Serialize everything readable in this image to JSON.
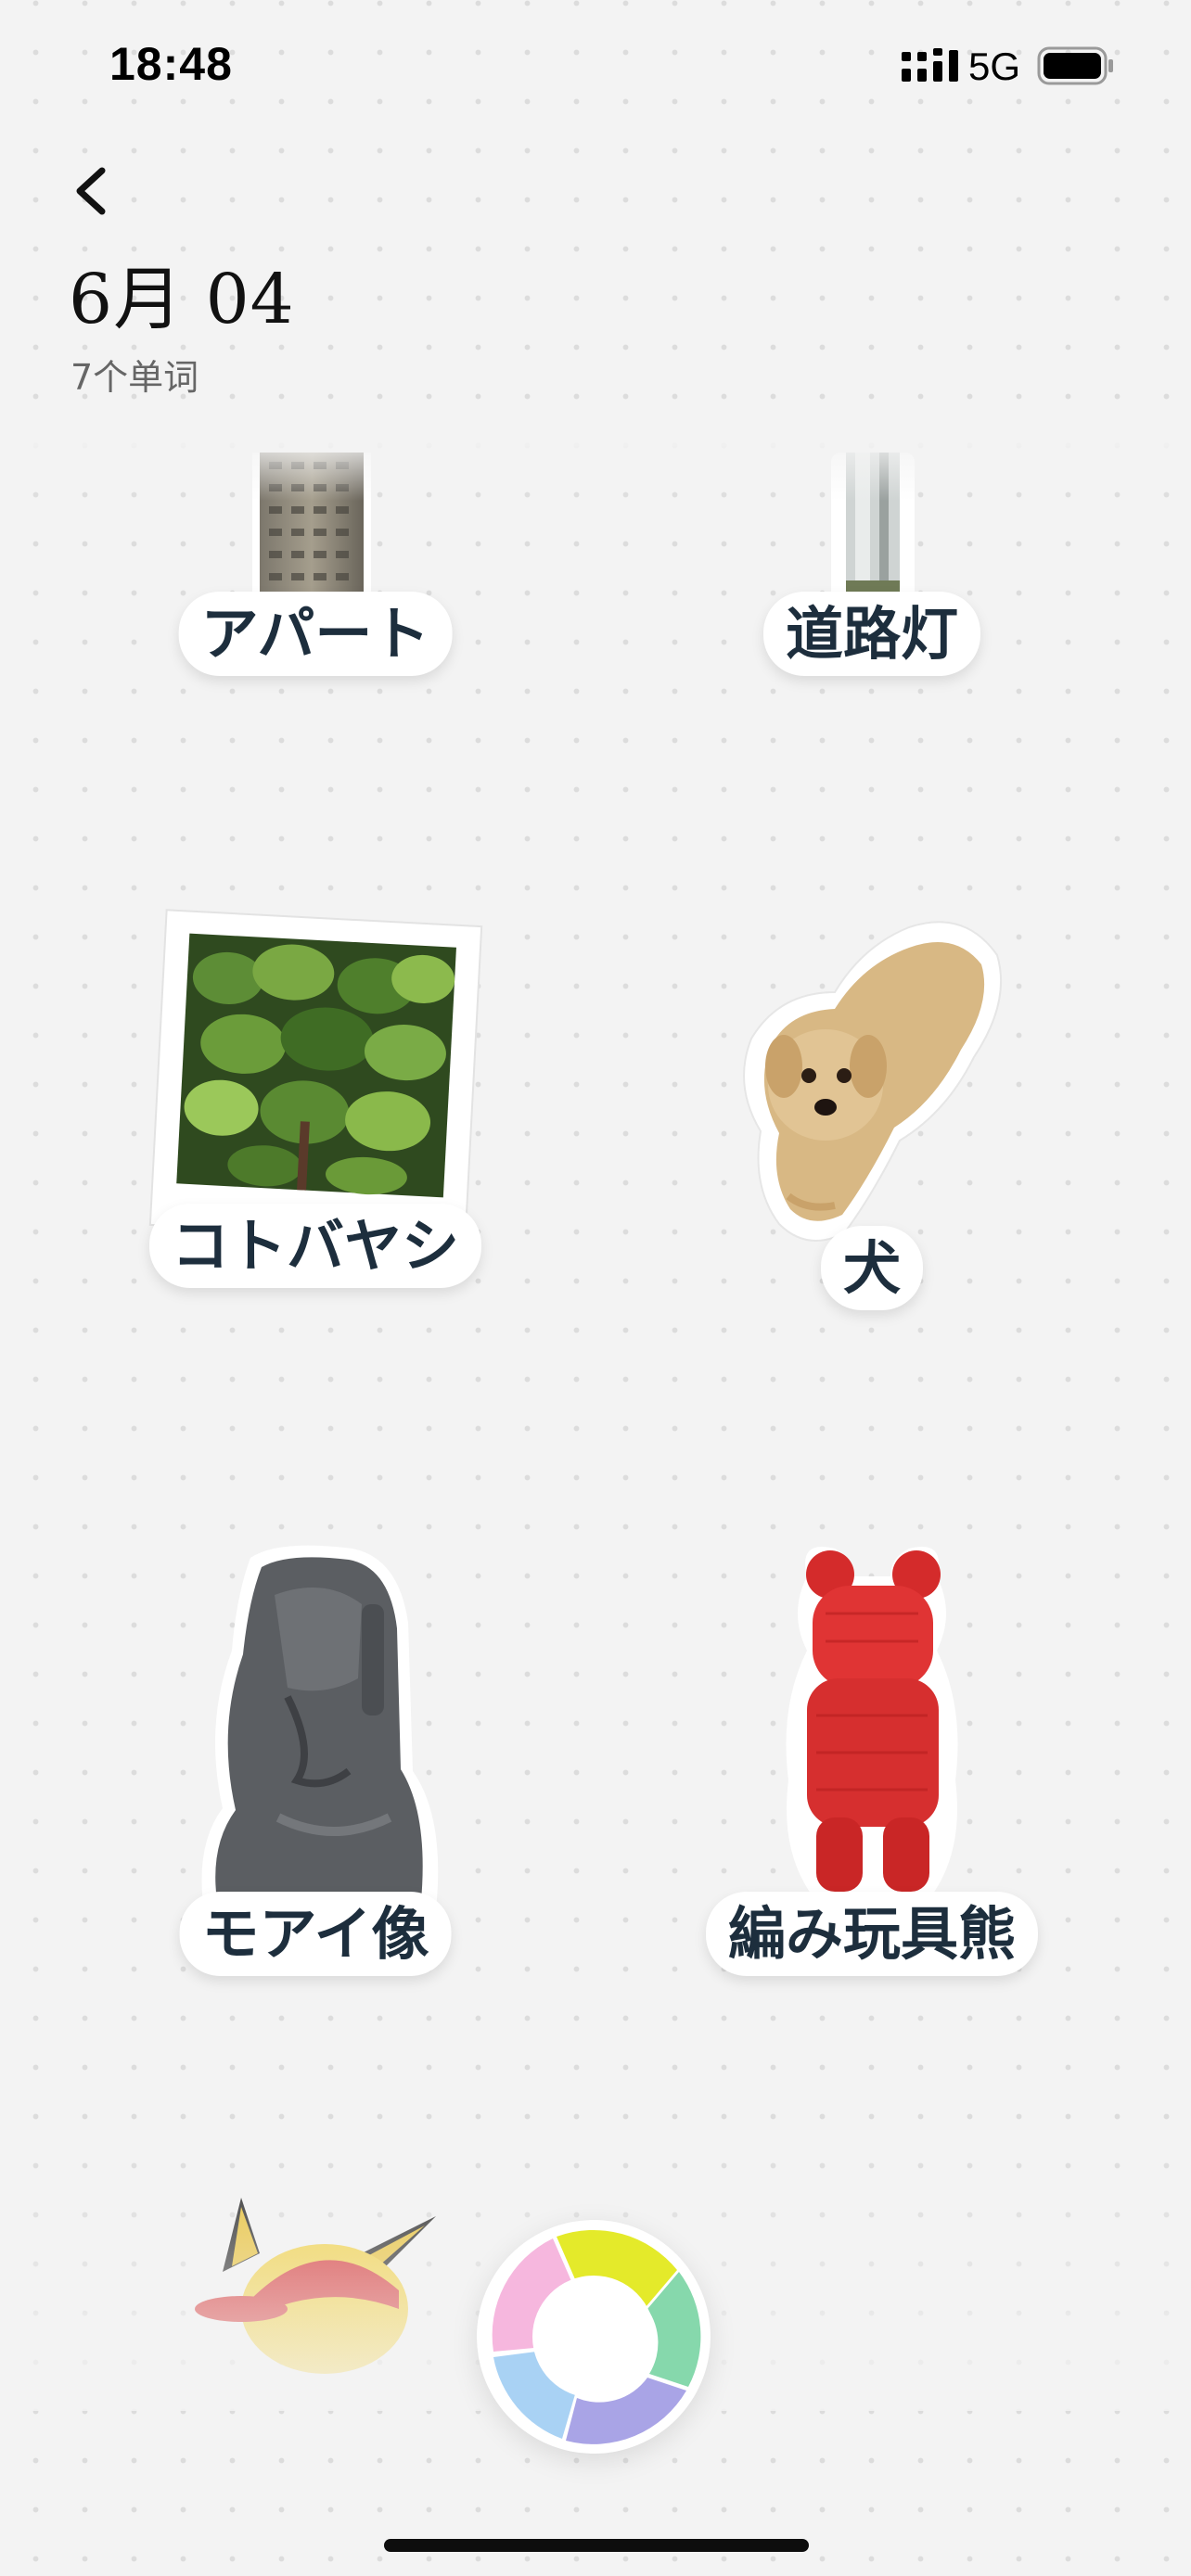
{
  "status_bar": {
    "time": "18:48",
    "network": "5G",
    "signal_icon": "cellular-signal-icon",
    "battery_icon": "battery-icon"
  },
  "header": {
    "back_icon": "chevron-left-icon",
    "title": "6月 04",
    "subtitle": "7个单词"
  },
  "words": [
    {
      "label": "アパート",
      "image": "apartment-building-photo"
    },
    {
      "label": "道路灯",
      "image": "street-lamp-photo"
    },
    {
      "label": "コトバヤシ",
      "image": "fiddle-leaf-fig-polaroid"
    },
    {
      "label": "犬",
      "image": "dog-sticker"
    },
    {
      "label": "モアイ像",
      "image": "moai-statue-sticker"
    },
    {
      "label": "編み玩具熊",
      "image": "knitted-red-bear-sticker"
    },
    {
      "label": "",
      "image": "pikachu-cap-sticker"
    }
  ],
  "capture_button": {
    "icon": "camera-shutter-icon"
  },
  "colors": {
    "background": "#f3f3f3",
    "label_text": "#1d2e3d",
    "shutter_yellow": "#e6ea2c",
    "shutter_green": "#7fd3a6",
    "shutter_purple": "#a7a2e4",
    "shutter_blue": "#a9d0f2",
    "shutter_pink": "#f5b4dc"
  }
}
